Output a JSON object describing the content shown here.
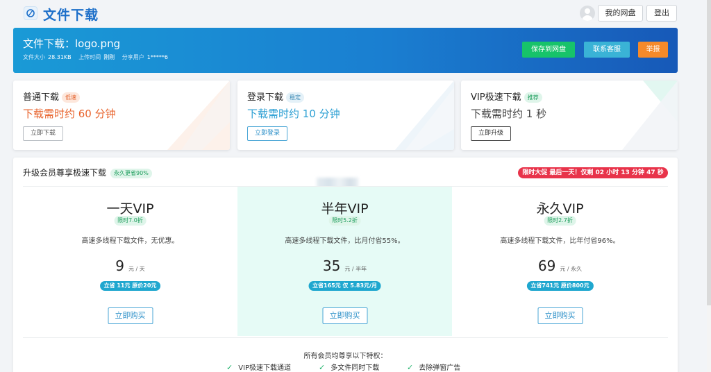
{
  "header": {
    "site_title": "文件下载",
    "my_disk": "我的网盘",
    "logout": "登出"
  },
  "banner": {
    "title": "文件下载：logo.png",
    "size_label": "文件大小",
    "size_value": "28.31KB",
    "upload_label": "上传时间",
    "upload_value": "刚刚",
    "sharer_label": "分享用户",
    "sharer_value": "1*****6",
    "save_button": "保存到网盘",
    "support_button": "联系客服",
    "report_button": "举报"
  },
  "cards": [
    {
      "title": "普通下载",
      "badge": "低速",
      "time": "下载需时约 60 分钟",
      "button": "立即下载"
    },
    {
      "title": "登录下载",
      "badge": "稳定",
      "time": "下载需时约 10 分钟",
      "button": "立即登录"
    },
    {
      "title": "VIP极速下载",
      "badge": "推荐",
      "time": "下载需时约 1 秒",
      "button": "立即升级"
    }
  ],
  "vip": {
    "title": "升级会员尊享极速下载",
    "title_badge": "永久更省90%",
    "promo": "限时大促 最后一天！仅剩 02 小时 13 分钟 47 秒",
    "plans": [
      {
        "name": "一天VIP",
        "tag": "限时7.0折",
        "desc": "高速多线程下载文件，无优惠。",
        "price": "9",
        "unit": "元 / 天",
        "save": "立省 11元 原价20元",
        "buy": "立即购买"
      },
      {
        "name": "半年VIP",
        "tag": "限时5.2折",
        "desc": "高速多线程下载文件，比月付省55%。",
        "price": "35",
        "unit": "元 / 半年",
        "save": "立省165元 仅 5.83元/月",
        "buy": "立即购买"
      },
      {
        "name": "永久VIP",
        "tag": "限时2.7折",
        "desc": "高速多线程下载文件，比年付省96%。",
        "price": "69",
        "unit": "元 / 永久",
        "save": "立省741元 原价800元",
        "buy": "立即购买"
      }
    ],
    "perks_title": "所有会员均尊享以下特权：",
    "perks": [
      "VIP极速下载通道",
      "多文件同时下载",
      "去除弹窗广告"
    ]
  },
  "colors": {
    "brand_blue": "#1d6fc9",
    "save_green": "#17c36a",
    "support_cyan": "#3ab3d6",
    "report_orange": "#f58a2a",
    "promo_red": "#e8334a"
  }
}
